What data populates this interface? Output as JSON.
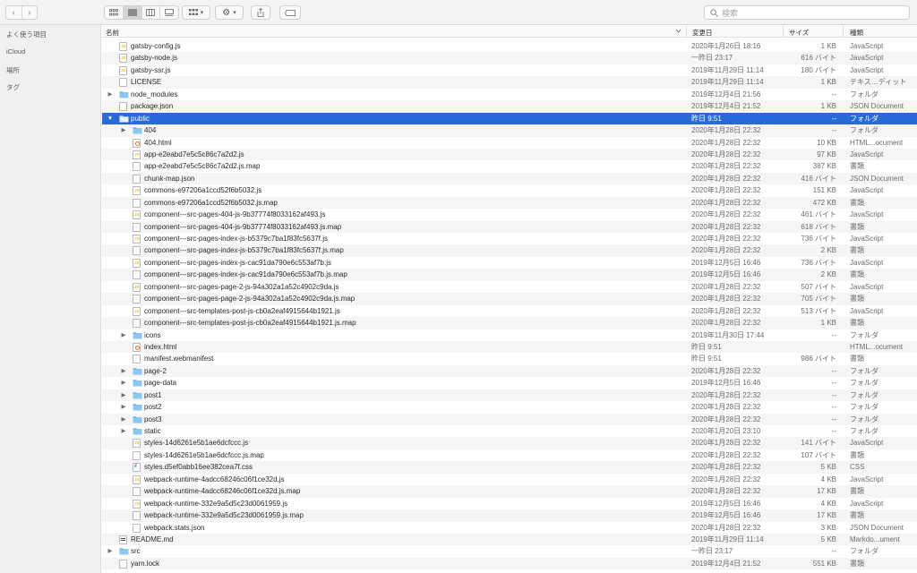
{
  "search": {
    "placeholder": "検索"
  },
  "sidebar": {
    "items": [
      {
        "label": "よく使う項目"
      },
      {
        "label": "iCloud"
      },
      {
        "label": "場所"
      },
      {
        "label": "タグ"
      }
    ]
  },
  "columns": {
    "name": "名前",
    "date": "変更日",
    "size": "サイズ",
    "kind": "種類"
  },
  "rows": [
    {
      "name": "gatsby-config.js",
      "date": "2020年1月26日 18:16",
      "size": "1 KB",
      "kind": "JavaScript",
      "icon": "js-file-icon",
      "depth": 0,
      "expander": ""
    },
    {
      "name": "gatsby-node.js",
      "date": "一昨日 23:17",
      "size": "616 バイト",
      "kind": "JavaScript",
      "icon": "js-file-icon",
      "depth": 0,
      "expander": ""
    },
    {
      "name": "gatsby-ssr.js",
      "date": "2019年11月29日 11:14",
      "size": "180 バイト",
      "kind": "JavaScript",
      "icon": "js-file-icon",
      "depth": 0,
      "expander": ""
    },
    {
      "name": "LICENSE",
      "date": "2019年11月29日 11:14",
      "size": "1 KB",
      "kind": "テキス…ディット",
      "icon": "text-file-icon",
      "depth": 0,
      "expander": ""
    },
    {
      "name": "node_modules",
      "date": "2019年12月4日 21:56",
      "size": "--",
      "kind": "フォルダ",
      "icon": "folder-icon",
      "depth": 0,
      "expander": "closed"
    },
    {
      "name": "package.json",
      "date": "2019年12月4日 21:52",
      "size": "1 KB",
      "kind": "JSON Document",
      "icon": "json-file-icon",
      "depth": 0,
      "expander": ""
    },
    {
      "name": "public",
      "date": "昨日 9:51",
      "size": "--",
      "kind": "フォルダ",
      "icon": "folder-icon",
      "depth": 0,
      "expander": "open",
      "selected": true
    },
    {
      "name": "404",
      "date": "2020年1月28日 22:32",
      "size": "--",
      "kind": "フォルダ",
      "icon": "folder-icon",
      "depth": 1,
      "expander": "closed"
    },
    {
      "name": "404.html",
      "date": "2020年1月28日 22:32",
      "size": "10 KB",
      "kind": "HTML...ocument",
      "icon": "html-file-icon",
      "depth": 1,
      "expander": ""
    },
    {
      "name": "app-e2eabd7e5c5c86c7a2d2.js",
      "date": "2020年1月28日 22:32",
      "size": "97 KB",
      "kind": "JavaScript",
      "icon": "js-file-icon",
      "depth": 1,
      "expander": ""
    },
    {
      "name": "app-e2eabd7e5c5c86c7a2d2.js.map",
      "date": "2020年1月28日 22:32",
      "size": "387 KB",
      "kind": "書類",
      "icon": "document-icon",
      "depth": 1,
      "expander": ""
    },
    {
      "name": "chunk-map.json",
      "date": "2020年1月28日 22:32",
      "size": "416 バイト",
      "kind": "JSON Document",
      "icon": "json-file-icon",
      "depth": 1,
      "expander": ""
    },
    {
      "name": "commons-e97206a1ccd52f6b5032.js",
      "date": "2020年1月28日 22:32",
      "size": "151 KB",
      "kind": "JavaScript",
      "icon": "js-file-icon",
      "depth": 1,
      "expander": ""
    },
    {
      "name": "commons-e97206a1ccd52f6b5032.js.map",
      "date": "2020年1月28日 22:32",
      "size": "472 KB",
      "kind": "書類",
      "icon": "document-icon",
      "depth": 1,
      "expander": ""
    },
    {
      "name": "component---src-pages-404-js-9b37774f8033162af493.js",
      "date": "2020年1月28日 22:32",
      "size": "461 バイト",
      "kind": "JavaScript",
      "icon": "js-file-icon",
      "depth": 1,
      "expander": ""
    },
    {
      "name": "component---src-pages-404-js-9b37774f8033162af493.js.map",
      "date": "2020年1月28日 22:32",
      "size": "618 バイト",
      "kind": "書類",
      "icon": "document-icon",
      "depth": 1,
      "expander": ""
    },
    {
      "name": "component---src-pages-index-js-b5379c7ba1f83fc5637f.js",
      "date": "2020年1月28日 22:32",
      "size": "736 バイト",
      "kind": "JavaScript",
      "icon": "js-file-icon",
      "depth": 1,
      "expander": ""
    },
    {
      "name": "component---src-pages-index-js-b5379c7ba1f83fc5637f.js.map",
      "date": "2020年1月28日 22:32",
      "size": "2 KB",
      "kind": "書類",
      "icon": "document-icon",
      "depth": 1,
      "expander": ""
    },
    {
      "name": "component---src-pages-index-js-cac91da790e6c553af7b.js",
      "date": "2019年12月5日 16:46",
      "size": "736 バイト",
      "kind": "JavaScript",
      "icon": "js-file-icon",
      "depth": 1,
      "expander": ""
    },
    {
      "name": "component---src-pages-index-js-cac91da790e6c553af7b.js.map",
      "date": "2019年12月5日 16:46",
      "size": "2 KB",
      "kind": "書類",
      "icon": "document-icon",
      "depth": 1,
      "expander": ""
    },
    {
      "name": "component---src-pages-page-2-js-94a302a1a52c4902c9da.js",
      "date": "2020年1月28日 22:32",
      "size": "507 バイト",
      "kind": "JavaScript",
      "icon": "js-file-icon",
      "depth": 1,
      "expander": ""
    },
    {
      "name": "component---src-pages-page-2-js-94a302a1a52c4902c9da.js.map",
      "date": "2020年1月28日 22:32",
      "size": "705 バイト",
      "kind": "書類",
      "icon": "document-icon",
      "depth": 1,
      "expander": ""
    },
    {
      "name": "component---src-templates-post-js-cb0a2eaf4915644b1921.js",
      "date": "2020年1月28日 22:32",
      "size": "513 バイト",
      "kind": "JavaScript",
      "icon": "js-file-icon",
      "depth": 1,
      "expander": ""
    },
    {
      "name": "component---src-templates-post-js-cb0a2eaf4915644b1921.js.map",
      "date": "2020年1月28日 22:32",
      "size": "1 KB",
      "kind": "書類",
      "icon": "document-icon",
      "depth": 1,
      "expander": ""
    },
    {
      "name": "icons",
      "date": "2019年11月30日 17:44",
      "size": "--",
      "kind": "フォルダ",
      "icon": "folder-icon",
      "depth": 1,
      "expander": "closed"
    },
    {
      "name": "index.html",
      "date": "昨日 9:51",
      "size": "",
      "kind": "HTML...ocument",
      "icon": "html-file-icon",
      "depth": 1,
      "expander": ""
    },
    {
      "name": "manifest.webmanifest",
      "date": "昨日 9:51",
      "size": "986 バイト",
      "kind": "書類",
      "icon": "document-icon",
      "depth": 1,
      "expander": ""
    },
    {
      "name": "page-2",
      "date": "2020年1月28日 22:32",
      "size": "--",
      "kind": "フォルダ",
      "icon": "folder-icon",
      "depth": 1,
      "expander": "closed"
    },
    {
      "name": "page-data",
      "date": "2019年12月5日 16:46",
      "size": "--",
      "kind": "フォルダ",
      "icon": "folder-icon",
      "depth": 1,
      "expander": "closed"
    },
    {
      "name": "post1",
      "date": "2020年1月28日 22:32",
      "size": "--",
      "kind": "フォルダ",
      "icon": "folder-icon",
      "depth": 1,
      "expander": "closed"
    },
    {
      "name": "post2",
      "date": "2020年1月28日 22:32",
      "size": "--",
      "kind": "フォルダ",
      "icon": "folder-icon",
      "depth": 1,
      "expander": "closed"
    },
    {
      "name": "post3",
      "date": "2020年1月28日 22:32",
      "size": "--",
      "kind": "フォルダ",
      "icon": "folder-icon",
      "depth": 1,
      "expander": "closed"
    },
    {
      "name": "static",
      "date": "2020年1月20日 23:10",
      "size": "--",
      "kind": "フォルダ",
      "icon": "folder-icon",
      "depth": 1,
      "expander": "closed"
    },
    {
      "name": "styles-14d6261e5b1ae6dcfccc.js",
      "date": "2020年1月28日 22:32",
      "size": "141 バイト",
      "kind": "JavaScript",
      "icon": "js-file-icon",
      "depth": 1,
      "expander": ""
    },
    {
      "name": "styles-14d6261e5b1ae6dcfccc.js.map",
      "date": "2020年1月28日 22:32",
      "size": "107 バイト",
      "kind": "書類",
      "icon": "document-icon",
      "depth": 1,
      "expander": ""
    },
    {
      "name": "styles.d5ef0abb16ee382cea7f.css",
      "date": "2020年1月28日 22:32",
      "size": "5 KB",
      "kind": "CSS",
      "icon": "css-file-icon",
      "depth": 1,
      "expander": ""
    },
    {
      "name": "webpack-runtime-4adcc68246c06f1ce32d.js",
      "date": "2020年1月28日 22:32",
      "size": "4 KB",
      "kind": "JavaScript",
      "icon": "js-file-icon",
      "depth": 1,
      "expander": ""
    },
    {
      "name": "webpack-runtime-4adcc68246c06f1ce32d.js.map",
      "date": "2020年1月28日 22:32",
      "size": "17 KB",
      "kind": "書類",
      "icon": "document-icon",
      "depth": 1,
      "expander": ""
    },
    {
      "name": "webpack-runtime-332e9a5d5c23d0061959.js",
      "date": "2019年12月5日 16:46",
      "size": "4 KB",
      "kind": "JavaScript",
      "icon": "js-file-icon",
      "depth": 1,
      "expander": ""
    },
    {
      "name": "webpack-runtime-332e9a5d5c23d0061959.js.map",
      "date": "2019年12月5日 16:46",
      "size": "17 KB",
      "kind": "書類",
      "icon": "document-icon",
      "depth": 1,
      "expander": ""
    },
    {
      "name": "webpack.stats.json",
      "date": "2020年1月28日 22:32",
      "size": "3 KB",
      "kind": "JSON Document",
      "icon": "json-file-icon",
      "depth": 1,
      "expander": ""
    },
    {
      "name": "README.md",
      "date": "2019年11月29日 11:14",
      "size": "5 KB",
      "kind": "Markdo...ument",
      "icon": "markdown-file-icon",
      "depth": 0,
      "expander": ""
    },
    {
      "name": "src",
      "date": "一昨日 23:17",
      "size": "--",
      "kind": "フォルダ",
      "icon": "folder-icon",
      "depth": 0,
      "expander": "closed"
    },
    {
      "name": "yarn.lock",
      "date": "2019年12月4日 21:52",
      "size": "551 KB",
      "kind": "書類",
      "icon": "document-icon",
      "depth": 0,
      "expander": ""
    }
  ],
  "colors": {
    "selection": "#2a69d9",
    "folder": "#6fb6ec",
    "js": "#e8c21a",
    "css": "#3a7bd5",
    "html": "#d9782a"
  }
}
